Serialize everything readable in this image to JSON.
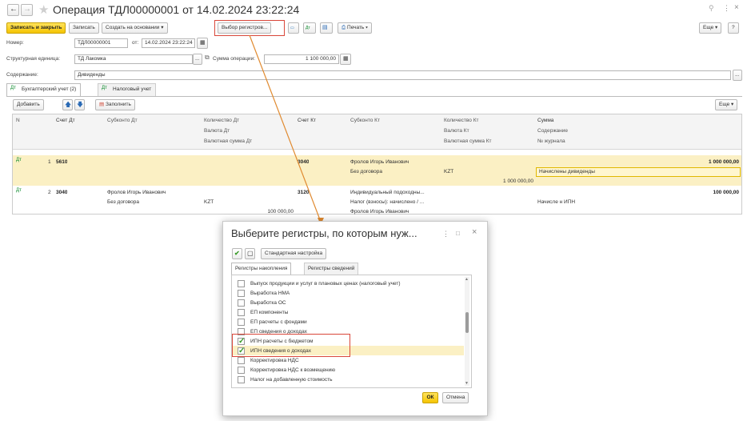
{
  "window": {
    "title": "Операция ТДЛ00000001 от 14.02.2024 23:22:24",
    "more_label": "Еще",
    "help_label": "?"
  },
  "toolbar": {
    "save_close": "Записать и закрыть",
    "save": "Записать",
    "create_based": "Создать на основании",
    "select_registers": "Выбор регистров...",
    "print": "Печать",
    "more": "Еще"
  },
  "header": {
    "number_label": "Номер:",
    "number_value": "ТДЛ00000001",
    "date_label": "от:",
    "date_value": "14.02.2024 23:22:24",
    "unit_label": "Структурная единица:",
    "unit_value": "ТД Лакомка",
    "sum_label": "Сумма операции:",
    "sum_value": "1 100 000,00",
    "content_label": "Содержание:",
    "content_value": "Дивиденды"
  },
  "tabs": [
    {
      "label": "Бухгалтерский учет (2)"
    },
    {
      "label": "Налоговый учет"
    }
  ],
  "table_toolbar": {
    "add": "Добавить",
    "fill": "Заполнить",
    "more": "Еще"
  },
  "table": {
    "headers": {
      "n": "N",
      "acc_dt": "Счет Дт",
      "subconto_dt": "Субконто Дт",
      "qty_dt": "Количество Дт",
      "cur_dt": "Валюта Дт",
      "cur_sum_dt": "Валютная сумма Дт",
      "acc_kt": "Счет Кт",
      "subconto_kt": "Субконто Кт",
      "qty_kt": "Количество Кт",
      "cur_kt": "Валюта Кт",
      "cur_sum_kt": "Валютная сумма Кт",
      "sum": "Сумма",
      "content": "Содержание",
      "journal": "№ журнала"
    },
    "rows": [
      {
        "n": "1",
        "acc_dt": "5610",
        "acc_kt": "3040",
        "sub_kt_1": "Фролов Игорь Иванович",
        "sub_kt_2": "Без договора",
        "cur_kt": "KZT",
        "cur_sum_kt": "1 000 000,00",
        "sum": "1 000 000,00",
        "content": "Начислены дивиденды"
      },
      {
        "n": "2",
        "acc_dt": "3040",
        "sub_dt_1": "Фролов Игорь Иванович",
        "sub_dt_2": "Без договора",
        "cur_dt": "KZT",
        "cur_sum_dt": "100 000,00",
        "acc_kt": "3120",
        "sub_kt_1": "Индивидуальный подоходны...",
        "sub_kt_2": "Налог (взносы): начислено / ...",
        "sub_kt_3": "Фролов Игорь Иванович",
        "sum": "100 000,00",
        "content": "Начисле н ИПН"
      }
    ]
  },
  "dialog": {
    "title": "Выберите регистры, по которым нуж...",
    "standard_setting": "Стандартная настройка",
    "tab_accumulation": "Регистры накопления",
    "tab_info": "Регистры сведений",
    "items": [
      {
        "label": "Выпуск продукции и услуг в плановых ценах (налоговый учет)",
        "checked": false
      },
      {
        "label": "Выработка НМА",
        "checked": false
      },
      {
        "label": "Выработка ОС",
        "checked": false
      },
      {
        "label": "ЕП компоненты",
        "checked": false
      },
      {
        "label": "ЕП расчеты с фондами",
        "checked": false
      },
      {
        "label": "ЕП сведения о доходах",
        "checked": false
      },
      {
        "label": "ИПН расчеты с бюджетом",
        "checked": true
      },
      {
        "label": "ИПН сведения о доходах",
        "checked": true
      },
      {
        "label": "Корректировка НДС",
        "checked": false
      },
      {
        "label": "Корректировка НДС к возмещению",
        "checked": false
      },
      {
        "label": "Налог на добавленную стоимость",
        "checked": false
      }
    ],
    "ok": "ОК",
    "cancel": "Отмена"
  },
  "colors": {
    "accent_yellow": "#f5c400",
    "selected_row": "#fbf0c4",
    "highlight_red": "#d9473a"
  }
}
